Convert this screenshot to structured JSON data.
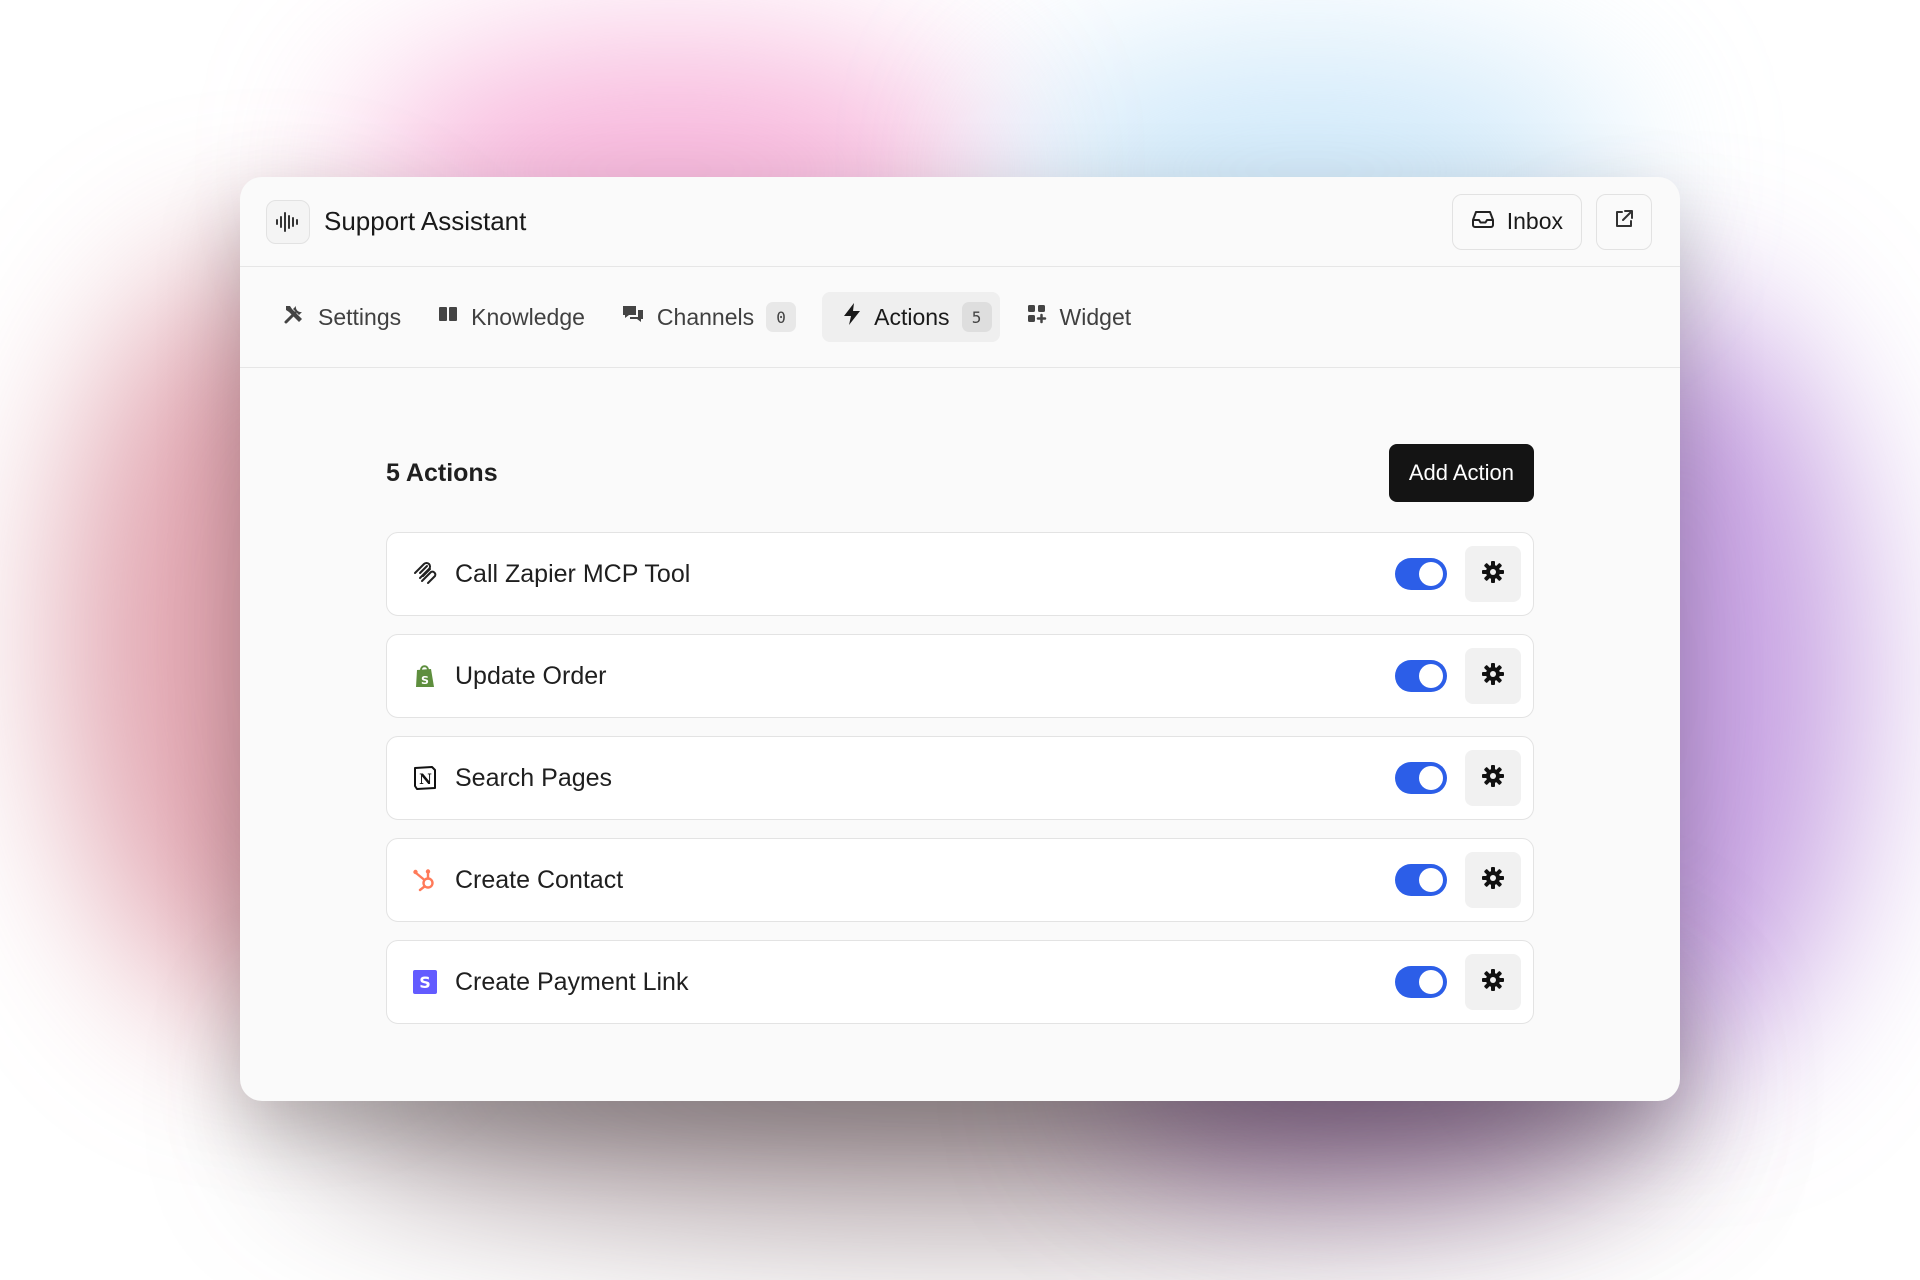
{
  "app": {
    "title": "Support Assistant",
    "icon": "waveform-icon"
  },
  "header": {
    "inbox_label": "Inbox",
    "inbox_icon": "inbox-tray-icon",
    "external_icon": "external-link-icon"
  },
  "tabs": [
    {
      "label": "Settings",
      "icon": "tools-icon",
      "count": null,
      "active": false
    },
    {
      "label": "Knowledge",
      "icon": "book-icon",
      "count": null,
      "active": false
    },
    {
      "label": "Channels",
      "icon": "chat-bubbles-icon",
      "count": "0",
      "active": false
    },
    {
      "label": "Actions",
      "icon": "bolt-icon",
      "count": "5",
      "active": true
    },
    {
      "label": "Widget",
      "icon": "grid-plus-icon",
      "count": null,
      "active": false
    }
  ],
  "actions_section": {
    "title": "5 Actions",
    "add_label": "Add Action"
  },
  "actions": [
    {
      "label": "Call Zapier MCP Tool",
      "icon": "zapier-mcp-icon",
      "enabled": true
    },
    {
      "label": "Update Order",
      "icon": "shopify-icon",
      "enabled": true
    },
    {
      "label": "Search Pages",
      "icon": "notion-icon",
      "enabled": true
    },
    {
      "label": "Create Contact",
      "icon": "hubspot-icon",
      "enabled": true
    },
    {
      "label": "Create Payment Link",
      "icon": "stripe-icon",
      "enabled": true
    }
  ],
  "colors": {
    "accent": "#2c5ee8",
    "primary_button": "#141414",
    "shopify": "#5e8e3e",
    "hubspot": "#ff7a59",
    "stripe": "#635bff"
  }
}
